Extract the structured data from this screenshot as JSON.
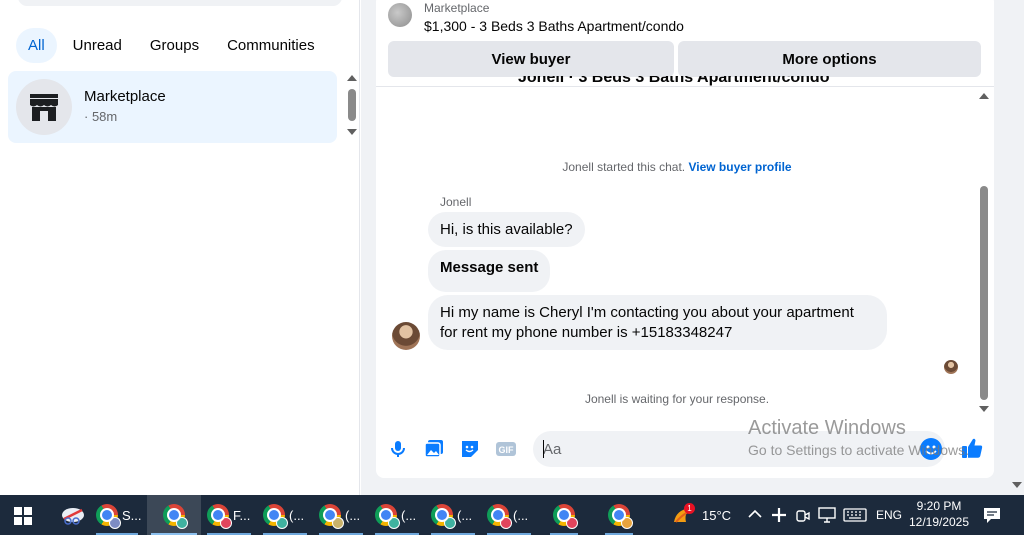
{
  "left_panel": {
    "filters": [
      {
        "label": "All"
      },
      {
        "label": "Unread"
      },
      {
        "label": "Groups"
      },
      {
        "label": "Communities"
      }
    ],
    "chat_item": {
      "name": "Marketplace",
      "time": "· 58m",
      "icon": "store-icon"
    }
  },
  "conversation": {
    "listing_source": "Marketplace",
    "listing_title": "$1,300 - 3 Beds 3 Baths Apartment/condo",
    "view_buyer_label": "View buyer",
    "more_options_label": "More options",
    "partial_heading": "Jonell · 3 Beds 3 Baths Apartment/condo",
    "started_text": "Jonell started this chat.",
    "view_profile_link": "View buyer profile",
    "sender_name": "Jonell",
    "messages": [
      {
        "text": "Hi, is this available?"
      },
      {
        "text": "Message sent"
      },
      {
        "line1": "Hi my name is Cheryl I'm contacting you about your apartment",
        "line2": "for rent my phone number is +15183348247"
      }
    ],
    "waiting_text": "Jonell is waiting for your response.",
    "composer_placeholder": "Aa",
    "composer_icons": [
      "microphone-icon",
      "photo-icon",
      "sticker-icon",
      "gif-icon",
      "emoji-icon",
      "thumbs-up-icon"
    ]
  },
  "watermark": {
    "title": "Activate Windows",
    "subtitle": "Go to Settings to activate Windows."
  },
  "taskbar": {
    "apps": [
      {
        "label": "S..."
      },
      {
        "label": "F..."
      },
      {
        "label": "(..."
      },
      {
        "label": "(..."
      },
      {
        "label": "(..."
      },
      {
        "label": "(..."
      },
      {
        "label": "(..."
      }
    ],
    "weather_badge": "1",
    "temperature": "15°C",
    "language": "ENG",
    "time": "9:20 PM",
    "date": "12/19/2025"
  },
  "colors": {
    "accent_blue": "#0064d1",
    "messenger_blue": "#0a7cff",
    "bubble_bg": "#f0f2f5",
    "taskbar_bg": "#1c2a3c"
  }
}
